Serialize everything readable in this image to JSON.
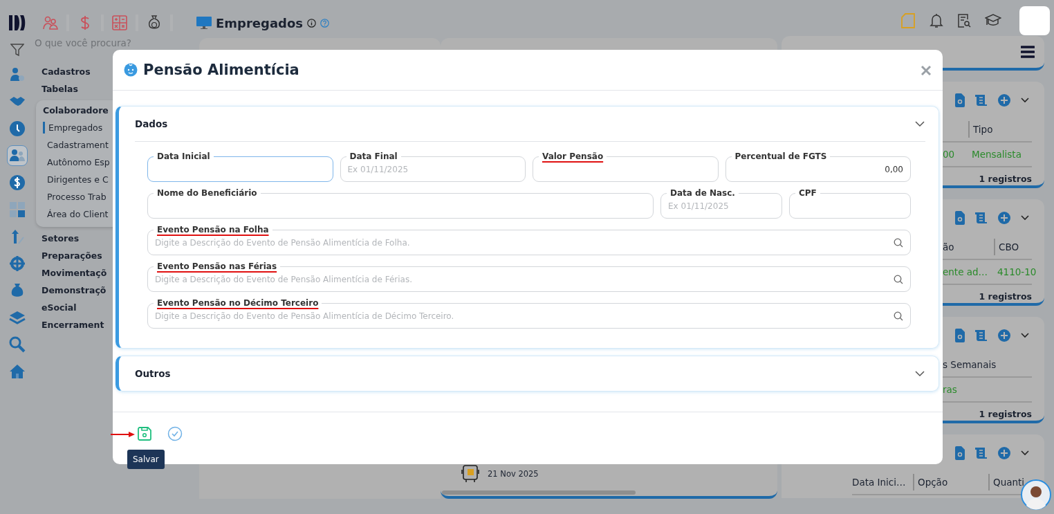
{
  "topbar": {
    "title": "Empregados"
  },
  "sidebar": {
    "search": {
      "placeholder": "O que você procura?"
    },
    "rail": [
      {
        "selected": false
      },
      {
        "selected": false
      },
      {
        "selected": false
      },
      {
        "selected": true
      },
      {
        "selected": false
      },
      {
        "selected": false
      },
      {
        "selected": false
      },
      {
        "selected": false
      },
      {
        "selected": false
      },
      {
        "selected": false
      },
      {
        "selected": false
      },
      {
        "selected": false
      }
    ],
    "menu": [
      {
        "label": "Cadastros",
        "expanded": false
      },
      {
        "label": "Tabelas",
        "expanded": false
      },
      {
        "label": "Colaboradore",
        "expanded": true,
        "children": [
          {
            "label": "Empregados",
            "selected": true
          },
          {
            "label": "Cadastrament",
            "selected": false
          },
          {
            "label": "Autônomo Esp",
            "selected": false
          },
          {
            "label": "Dirigentes e C",
            "selected": false
          },
          {
            "label": "Processo Trab",
            "selected": false
          },
          {
            "label": "Área do Client",
            "selected": false
          }
        ]
      },
      {
        "label": "Setores",
        "expanded": false
      },
      {
        "label": "Preparações",
        "expanded": false
      },
      {
        "label": "Movimentaçõ",
        "expanded": false
      },
      {
        "label": "Demonstraçõ",
        "expanded": false
      },
      {
        "label": "eSocial",
        "expanded": false
      },
      {
        "label": "Encerrament",
        "expanded": false
      }
    ]
  },
  "timeline": {
    "date": "21 Nov 2025"
  },
  "right_panel": {
    "cards": [
      {
        "columns": [
          {
            "cell": "00"
          },
          {
            "header": "Tipo",
            "cell": "Mensalista"
          }
        ],
        "footer": "1 registros"
      },
      {
        "columns": [
          {
            "header": "ão",
            "cell": "ente ad…"
          },
          {
            "header": "CBO",
            "cell": "4110-10"
          }
        ],
        "footer": "1 registros"
      },
      {
        "columns": [
          {
            "header": "s Semanais",
            "cell": "ras"
          }
        ],
        "footer": "1 registros"
      },
      {
        "columns": [
          {
            "header": "Data Inici…"
          },
          {
            "header": "Opção"
          },
          {
            "header": "Quanti"
          }
        ]
      }
    ]
  },
  "modal": {
    "title": "Pensão Alimentícia",
    "sections": [
      {
        "title": "Dados",
        "expanded": true,
        "fields": [
          {
            "label": "Data Inicial",
            "kind": "text",
            "focused": true,
            "highlighted": false
          },
          {
            "label": "Data Final",
            "kind": "text",
            "placeholder": "Ex 01/11/2025",
            "focused": false,
            "highlighted": false
          },
          {
            "label": "Valor Pensão",
            "kind": "text",
            "focused": false,
            "highlighted": true
          },
          {
            "label": "Percentual de FGTS",
            "kind": "number",
            "value": "0,00",
            "focused": false,
            "highlighted": false
          },
          {
            "label": "Nome do Beneficiário",
            "kind": "text",
            "focused": false,
            "highlighted": false
          },
          {
            "label": "Data de Nasc.",
            "kind": "text",
            "placeholder": "Ex 01/11/2025",
            "focused": false,
            "highlighted": false
          },
          {
            "label": "CPF",
            "kind": "text",
            "focused": false,
            "highlighted": false
          },
          {
            "label": "Evento Pensão na Folha",
            "kind": "search",
            "placeholder": "Digite a Descrição do Evento de Pensão Alimentícia de Folha.",
            "focused": false,
            "highlighted": true
          },
          {
            "label": "Evento Pensão nas Férias",
            "kind": "search",
            "placeholder": "Digite a Descrição do Evento de Pensão Alimentícia de Férias.",
            "focused": false,
            "highlighted": true
          },
          {
            "label": "Evento Pensão no Décimo Terceiro",
            "kind": "search",
            "placeholder": "Digite a Descrição do Evento de Pensão Alimentícia de Décimo Terceiro.",
            "focused": false,
            "highlighted": true
          }
        ]
      },
      {
        "title": "Outros",
        "expanded": false
      }
    ],
    "actions": [
      {
        "kind": "save",
        "tooltip": "Salvar",
        "marked": true
      },
      {
        "kind": "confirm",
        "marked": false
      }
    ]
  }
}
